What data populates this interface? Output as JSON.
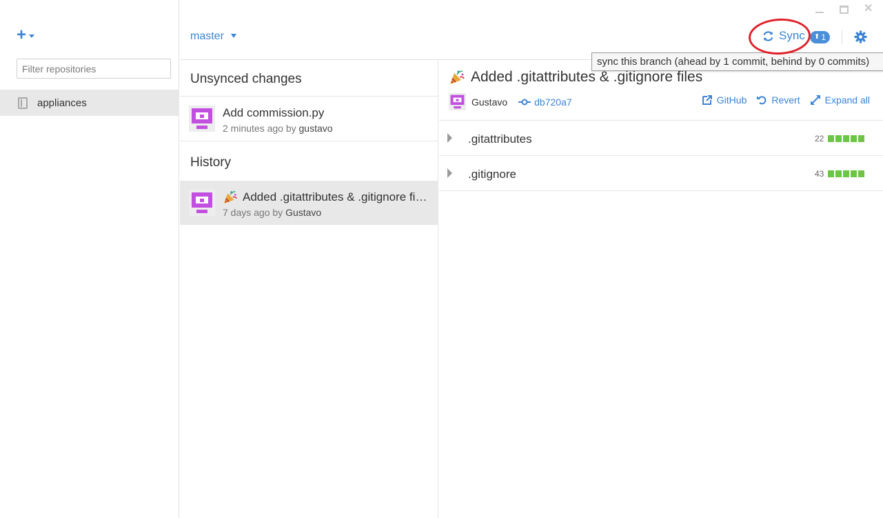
{
  "window": {
    "minimize": "minimize",
    "maximize": "maximize",
    "close": "close"
  },
  "sidebar": {
    "filter_placeholder": "Filter repositories",
    "repositories": [
      {
        "label": "appliances",
        "selected": true
      }
    ]
  },
  "header": {
    "branch": "master",
    "sync_label": "Sync",
    "ahead_count": "1",
    "tooltip": "sync this branch (ahead by 1 commit, behind by 0 commits)"
  },
  "middle": {
    "unsynced_title": "Unsynced changes",
    "unsynced": [
      {
        "title": "Add commission.py",
        "time": "2 minutes ago by ",
        "author": "gustavo"
      }
    ],
    "history_title": "History",
    "history": [
      {
        "title": "Added .gitattributes & .gitignore files",
        "time": "7 days ago by ",
        "author": "Gustavo",
        "selected": true
      }
    ]
  },
  "detail": {
    "title": "Added .gitattributes & .gitignore files",
    "author": "Gustavo",
    "sha": "db720a7",
    "actions": {
      "github": "GitHub",
      "revert": "Revert",
      "expand": "Expand all"
    },
    "files": [
      {
        "name": ".gitattributes",
        "additions": "22"
      },
      {
        "name": ".gitignore",
        "additions": "43"
      }
    ]
  },
  "colors": {
    "accent": "#3b83d4",
    "avatar": "#c24fe0",
    "diff_add": "#6cc644",
    "annotation": "#e0202a"
  }
}
